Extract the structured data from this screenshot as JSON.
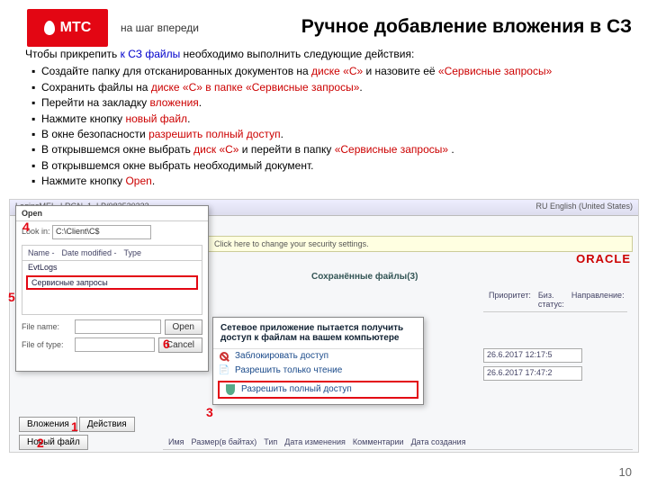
{
  "logo": {
    "text": "МТС",
    "slogan": "на шаг впереди"
  },
  "title": "Ручное добавление вложения в СЗ",
  "intro": {
    "pre": "Чтобы прикрепить ",
    "link": "к СЗ файлы",
    "post": " необходимо выполнить следующие действия:"
  },
  "bullets": [
    {
      "pre": "Создайте папку для отсканированных документов на ",
      "r1": "диске «С»",
      "mid": " и назовите её ",
      "r2": "«Сервисные запросы»"
    },
    {
      "pre": "Сохранить файлы на ",
      "r1": "диске «С» в папке «Сервисные запросы»",
      "post": "."
    },
    {
      "pre": "Перейти на закладку ",
      "r1": "вложения",
      "post": "."
    },
    {
      "pre": "Нажмите кнопку ",
      "r1": "новый файл",
      "post": "."
    },
    {
      "pre": "В окне безопасности ",
      "r1": "разрешить полный доступ",
      "post": "."
    },
    {
      "pre": "В открывшемся окне выбрать ",
      "r1": "диск «С»",
      "mid": " и перейти в папку ",
      "r2": "«Сервисные запросы»",
      "post": " ."
    },
    {
      "plain": "В открывшемся окне выбрать необходимый документ."
    },
    {
      "pre": "Нажмите кнопку ",
      "r1": "Open",
      "post": "."
    }
  ],
  "open": {
    "title": "Open",
    "lookin": "Look in:",
    "path": "C:\\Client\\C$",
    "folders": {
      "h1": "Name -",
      "h2": "Date modified -",
      "h3": "Type",
      "f1": "EvtLogs",
      "f2": "Сервисные запросы"
    },
    "filename_lbl": "File name:",
    "filetype_lbl": "File of type:",
    "open_btn": "Open",
    "cancel_btn": "Cancel"
  },
  "browser": {
    "topbar": "LoginsMEL_LRGN_1_LP/082520233",
    "lang": "RU English (United States)",
    "warn": "Click here to change your security settings.",
    "section": "Сохранённые файлы(3)",
    "cols": {
      "c1": "Имя",
      "c2": "Размер(в байтах)",
      "c3": "Тип",
      "c4": "Дата изменения",
      "c5": "Комментарии",
      "c6": "Дата создания"
    }
  },
  "tabs": {
    "t1": "Вложения",
    "t2": "Действия"
  },
  "newfile": "Новый файл",
  "sec": {
    "heading": "Сетевое приложение пытается получить доступ к файлам на вашем компьютере",
    "opt1": "Заблокировать доступ",
    "opt2": "Разрешить только чтение",
    "opt3": "Разрешить полный доступ"
  },
  "right": {
    "c1": "Приоритет:",
    "c2": "Биз. статус:",
    "c3": "Направление:",
    "d1": "26.6.2017 12:17:5",
    "d2": "26.6.2017 17:47:2"
  },
  "nums": {
    "n1": "1",
    "n2": "2",
    "n3": "3",
    "n4": "4",
    "n5": "5",
    "n6": "6"
  },
  "page": "10"
}
